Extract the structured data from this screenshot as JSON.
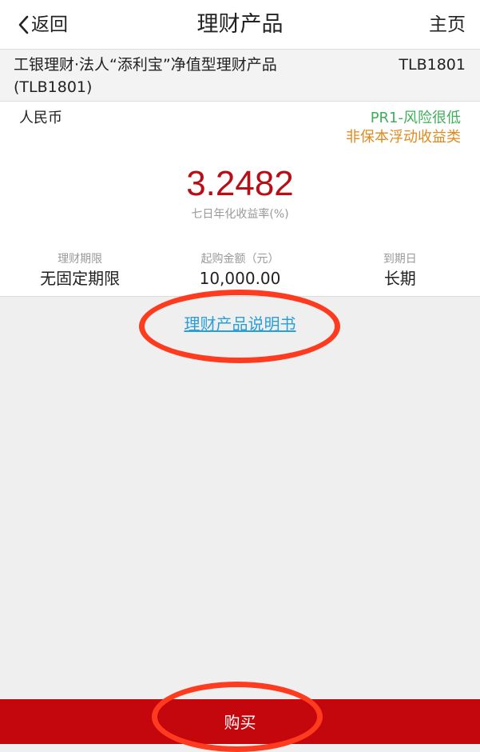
{
  "nav": {
    "back_label": "返回",
    "title": "理财产品",
    "home_label": "主页"
  },
  "product": {
    "name": "工银理财·法人“添利宝”净值型理财产品(TLB1801)",
    "code": "TLB1801",
    "currency": "人民币",
    "risk_level": "PR1-风险很低",
    "income_type": "非保本浮动收益类",
    "rate_value": "3.2482",
    "rate_label": "七日年化收益率(%)",
    "stats": [
      {
        "label": "理财期限",
        "value": "无固定期限"
      },
      {
        "label": "起购金额（元）",
        "value": "10,000.00"
      },
      {
        "label": "到期日",
        "value": "长期"
      }
    ]
  },
  "prospectus_link": "理财产品说明书",
  "buy_button": "购买",
  "colors": {
    "rate": "#b80f16",
    "risk": "#3fae5a",
    "income_type": "#e08a1e",
    "link": "#2a9fd6",
    "buy_bar": "#c4060d",
    "annotation": "#ff3b1f"
  },
  "icons": {
    "back": "chevron-left-icon"
  }
}
